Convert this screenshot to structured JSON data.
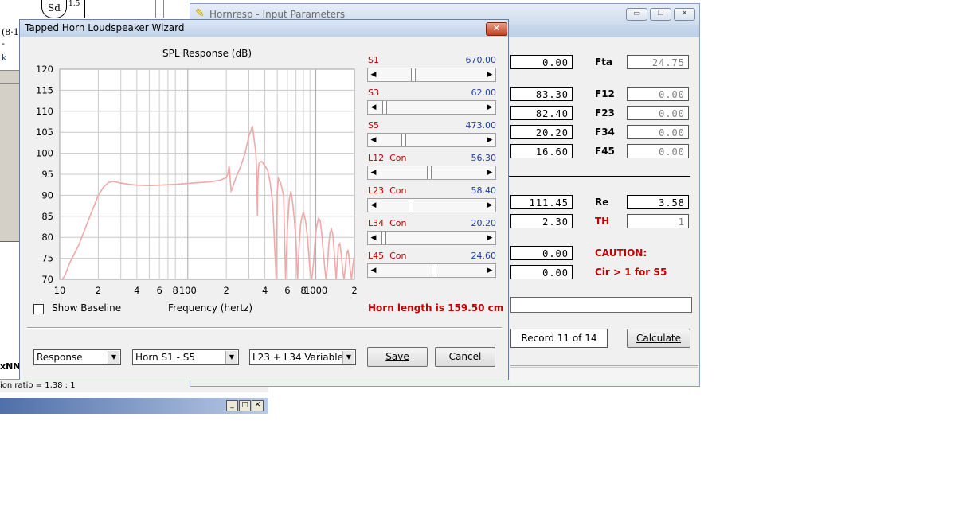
{
  "bg_left": {
    "frac_sd": "Sd",
    "frac_exp": "1.5",
    "frag_1": "(8·1",
    "frag_2": "-",
    "frag_3": "k",
    "frag_4": "xNN",
    "status": "ion ratio = 1,38 : 1"
  },
  "hornresp": {
    "title": "Hornresp - Input Parameters",
    "fields_left": [
      "0.00",
      "83.30",
      "82.40",
      "20.20",
      "16.60",
      "111.45",
      "2.30",
      "0.00",
      "0.00"
    ],
    "right_labels": [
      "Fta",
      "F12",
      "F23",
      "F34",
      "F45",
      "Re",
      "TH"
    ],
    "right_values": [
      "24.75",
      "0.00",
      "0.00",
      "0.00",
      "0.00",
      "3.58",
      "1"
    ],
    "caution_title": "CAUTION:",
    "caution_msg": "Cir > 1 for S5",
    "record": "Record 11 of 14",
    "calculate": "Calculate"
  },
  "wizard": {
    "title": "Tapped Horn Loudspeaker Wizard",
    "close": "✕",
    "chart_title": "SPL Response (dB)",
    "xlabel": "Frequency (hertz)",
    "show_baseline": "Show Baseline",
    "sliders": [
      {
        "label": "S1",
        "value": "670.00",
        "pos": 0.32
      },
      {
        "label": "S3",
        "value": "62.00",
        "pos": 0.03
      },
      {
        "label": "S5",
        "value": "473.00",
        "pos": 0.22
      },
      {
        "label": "L12  Con",
        "value": "56.30",
        "pos": 0.48
      },
      {
        "label": "L23  Con",
        "value": "58.40",
        "pos": 0.29
      },
      {
        "label": "L34  Con",
        "value": "20.20",
        "pos": 0.02
      },
      {
        "label": "L45  Con",
        "value": "24.60",
        "pos": 0.52
      }
    ],
    "horn_length": "Horn length is 159.50 cm",
    "combo1": "Response",
    "combo2": "Horn S1 - S5",
    "combo3": "L23 + L34 Variable",
    "save": "Save",
    "cancel": "Cancel",
    "icons": [
      "pencil-icon",
      "close-icon",
      "minimize-icon",
      "maximize-icon",
      "chevron-down-icon"
    ]
  },
  "chart_data": {
    "type": "line",
    "title": "SPL Response (dB)",
    "xlabel": "Frequency (hertz)",
    "ylabel": "",
    "x_scale": "log",
    "xlim": [
      10,
      2000
    ],
    "ylim": [
      70,
      120
    ],
    "y_ticks": [
      120,
      115,
      110,
      105,
      100,
      95,
      90,
      85,
      80,
      75,
      70
    ],
    "x_tick_labels": [
      "10",
      "2",
      "4",
      "6",
      "8",
      "100",
      "2",
      "4",
      "6",
      "8",
      "1000",
      "2"
    ],
    "x_tick_values": [
      10,
      20,
      40,
      60,
      80,
      100,
      200,
      400,
      600,
      800,
      1000,
      2000
    ],
    "grid": true,
    "line_color": "#f0a8a8",
    "series": [
      {
        "x": [
          10,
          11,
          12,
          14,
          16,
          18,
          20,
          22,
          24,
          26,
          28,
          30,
          35,
          40,
          50,
          60,
          80,
          100,
          120,
          150,
          180,
          200,
          205,
          210,
          212,
          215,
          218,
          222,
          230,
          240,
          260,
          280,
          300,
          320,
          340,
          345,
          350,
          352,
          355,
          360,
          370,
          380,
          400,
          420,
          440,
          460,
          480,
          490,
          495,
          500,
          510,
          530,
          560,
          570,
          580,
          600,
          620,
          640,
          660,
          680,
          700,
          710,
          720,
          740,
          760,
          780,
          800,
          830,
          860,
          880,
          900,
          930,
          960,
          990,
          1020,
          1050,
          1080,
          1110,
          1140,
          1170,
          1200,
          1230,
          1260,
          1290,
          1320,
          1350,
          1380,
          1410,
          1440,
          1470,
          1500,
          1540,
          1580,
          1620,
          1660,
          1700,
          1740,
          1780,
          1820,
          1860,
          1900,
          1940,
          1980,
          2000
        ],
        "y": [
          69,
          71,
          74,
          78,
          82.5,
          86.5,
          90,
          92,
          93,
          93.3,
          93.1,
          92.9,
          92.6,
          92.4,
          92.3,
          92.4,
          92.6,
          92.8,
          93.0,
          93.2,
          93.6,
          94.2,
          95,
          97,
          96,
          93,
          91,
          91.5,
          93,
          94.5,
          97,
          100,
          104,
          106.5,
          100,
          95,
          85,
          92,
          96,
          97.5,
          98,
          98,
          97,
          96,
          93,
          88,
          76,
          70,
          82,
          91,
          94,
          93,
          90,
          80,
          70,
          82,
          89,
          91,
          88,
          84,
          79,
          74,
          70,
          78,
          83,
          85,
          86,
          84,
          80,
          76,
          72,
          70,
          74,
          80,
          83,
          84.5,
          84,
          81,
          77,
          73,
          70,
          73,
          78,
          81,
          82,
          81,
          78,
          74,
          70,
          74,
          78,
          78.5,
          76,
          72,
          70,
          73,
          76,
          77,
          75,
          72,
          70,
          73,
          75,
          74
        ]
      }
    ]
  }
}
